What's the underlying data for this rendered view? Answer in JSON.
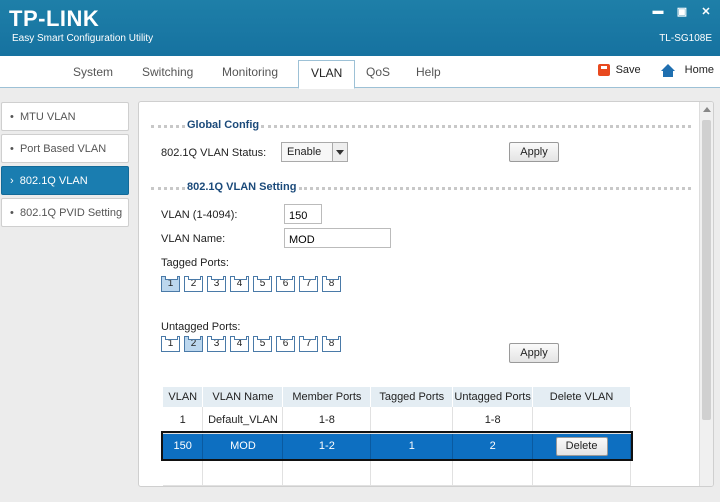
{
  "header": {
    "logo": "TP-LINK",
    "subtitle": "Easy Smart Configuration Utility",
    "model": "TL-SG108E",
    "minimize": "▬",
    "maximize": "▣",
    "close": "✕"
  },
  "nav": {
    "tabs": [
      {
        "label": "System"
      },
      {
        "label": "Switching"
      },
      {
        "label": "Monitoring"
      },
      {
        "label": "VLAN",
        "active": true
      },
      {
        "label": "QoS"
      },
      {
        "label": "Help"
      }
    ],
    "save_label": "Save",
    "home_label": "Home"
  },
  "sidebar": {
    "items": [
      {
        "label": "MTU VLAN"
      },
      {
        "label": "Port Based VLAN"
      },
      {
        "label": "802.1Q VLAN",
        "active": true
      },
      {
        "label": "802.1Q PVID Setting"
      }
    ]
  },
  "global": {
    "title": "Global Config",
    "status_label": "802.1Q VLAN Status:",
    "status_value": "Enable",
    "apply_label": "Apply"
  },
  "setting": {
    "title": "802.1Q VLAN Setting",
    "vlan_id_label": "VLAN (1-4094):",
    "vlan_id_value": "150",
    "vlan_name_label": "VLAN Name:",
    "vlan_name_value": "MOD",
    "tagged_label": "Tagged Ports:",
    "untagged_label": "Untagged Ports:",
    "apply_label": "Apply",
    "tagged_ports": [
      {
        "n": "1",
        "on": true
      },
      {
        "n": "2"
      },
      {
        "n": "3"
      },
      {
        "n": "4"
      },
      {
        "n": "5"
      },
      {
        "n": "6"
      },
      {
        "n": "7"
      },
      {
        "n": "8"
      }
    ],
    "untagged_ports": [
      {
        "n": "1"
      },
      {
        "n": "2",
        "on": true
      },
      {
        "n": "3"
      },
      {
        "n": "4"
      },
      {
        "n": "5"
      },
      {
        "n": "6"
      },
      {
        "n": "7"
      },
      {
        "n": "8"
      }
    ]
  },
  "table": {
    "headers": [
      "VLAN",
      "VLAN Name",
      "Member Ports",
      "Tagged Ports",
      "Untagged Ports",
      "Delete VLAN"
    ],
    "rows": [
      {
        "vlan": "1",
        "name": "Default_VLAN",
        "member": "1-8",
        "tagged": "",
        "untagged": "1-8",
        "delete": ""
      },
      {
        "vlan": "150",
        "name": "MOD",
        "member": "1-2",
        "tagged": "1",
        "untagged": "2",
        "delete": "Delete"
      }
    ]
  },
  "colors": {
    "header_bg": "#1672a0",
    "accent": "#1a7db0",
    "selected_row": "#0d6fc1"
  }
}
